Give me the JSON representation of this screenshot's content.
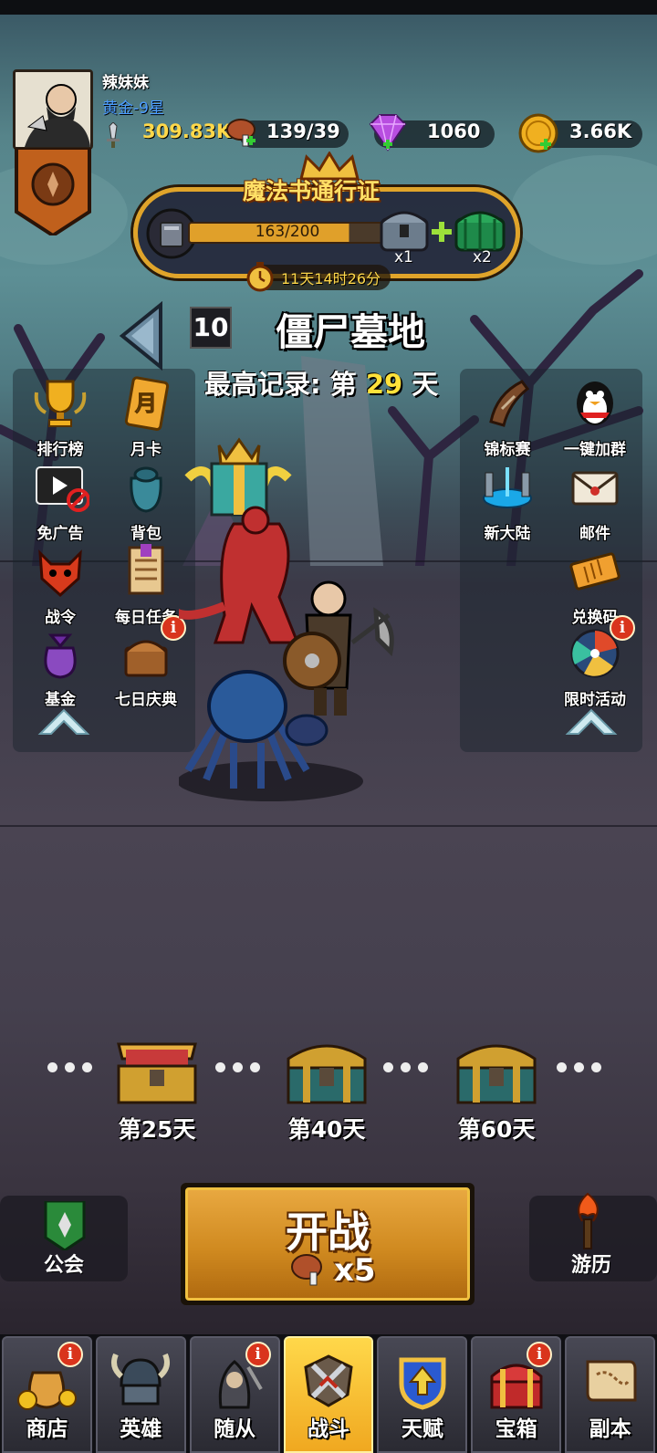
{
  "player": {
    "name": "辣妹妹",
    "rank": "黄金-9星",
    "power": "309.83K"
  },
  "resources": {
    "meat": "139/39",
    "gems": "1060",
    "gold": "3.66K"
  },
  "pass": {
    "title": "魔法书通行证",
    "progress_text": "163/200",
    "progress": 0.815,
    "reward1_count": "x1",
    "reward2_count": "x2",
    "timer": "11天14时26分"
  },
  "stage": {
    "level": "10",
    "name": "僵尸墓地",
    "record_prefix": "最高记录: 第",
    "record_day": "29",
    "record_suffix": "天"
  },
  "left_menu": {
    "ranking": "排行榜",
    "month_card": "月卡",
    "month_glyph": "月",
    "no_ads": "免广告",
    "backpack": "背包",
    "battle_pass": "战令",
    "daily_tasks": "每日任务",
    "fund": "基金",
    "seven_day": "七日庆典"
  },
  "right_menu": {
    "tournament": "锦标赛",
    "join_group": "一键加群",
    "new_land": "新大陆",
    "mail": "邮件",
    "redeem": "兑换码",
    "limited_event": "限时活动"
  },
  "chests": [
    {
      "label": "第25天"
    },
    {
      "label": "第40天"
    },
    {
      "label": "第60天"
    }
  ],
  "actions": {
    "guild": "公会",
    "fight": "开战",
    "fight_cost": "x5",
    "travel": "游历"
  },
  "nav": {
    "shop": "商店",
    "heroes": "英雄",
    "followers": "随从",
    "battle": "战斗",
    "talent": "天赋",
    "chest": "宝箱",
    "dungeon": "副本"
  },
  "badge_text": "i",
  "colors": {
    "accent_gold": "#ffe23a",
    "rank_blue": "#4a9bff",
    "badge_red": "#d9341c"
  }
}
